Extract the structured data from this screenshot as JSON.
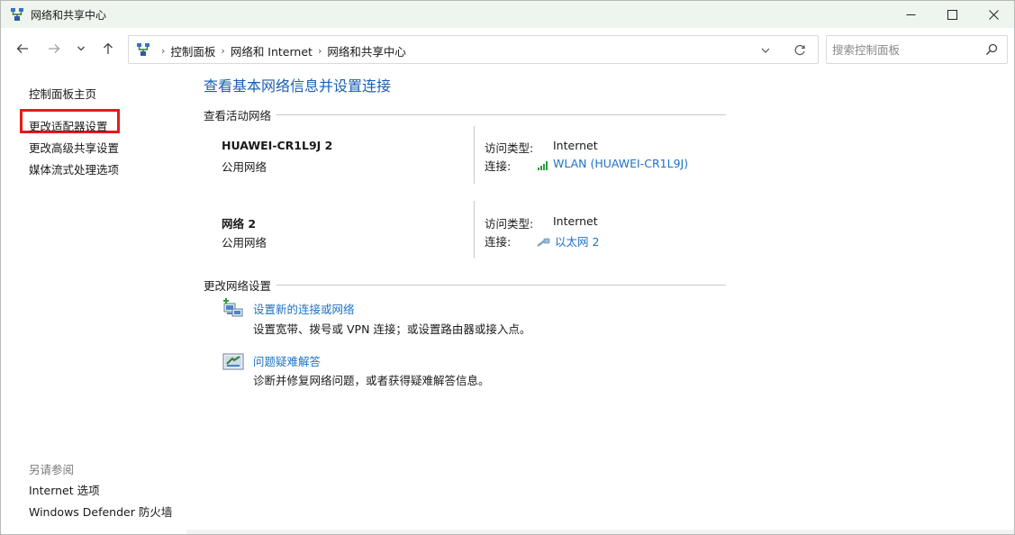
{
  "window": {
    "title": "网络和共享中心"
  },
  "navigation": {
    "breadcrumbs": [
      "控制面板",
      "网络和 Internet",
      "网络和共享中心"
    ],
    "search_placeholder": "搜索控制面板"
  },
  "left_pane": {
    "links": [
      "控制面板主页",
      "更改适配器设置",
      "更改高级共享设置",
      "媒体流式处理选项"
    ],
    "highlighted_index": 1,
    "see_also_title": "另请参阅",
    "see_also_links": [
      "Internet 选项",
      "Windows Defender 防火墙"
    ]
  },
  "main": {
    "title": "查看基本网络信息并设置连接",
    "active_networks_heading": "查看活动网络",
    "networks": [
      {
        "name": "HUAWEI-CR1L9J 2",
        "type": "公用网络",
        "access_label": "访问类型:",
        "access_value": "Internet",
        "connection_label": "连接:",
        "connection_value": "WLAN (HUAWEI-CR1L9J)",
        "connection_icon": "wifi-signal-icon"
      },
      {
        "name": "网络 2",
        "type": "公用网络",
        "access_label": "访问类型:",
        "access_value": "Internet",
        "connection_label": "连接:",
        "connection_value": "以太网 2",
        "connection_icon": "ethernet-cable-icon"
      }
    ],
    "change_settings_heading": "更改网络设置",
    "tasks": [
      {
        "link": "设置新的连接或网络",
        "description": "设置宽带、拨号或 VPN 连接；或设置路由器或接入点。",
        "icon": "new-connection-icon"
      },
      {
        "link": "问题疑难解答",
        "description": "诊断并修复网络问题，或者获得疑难解答信息。",
        "icon": "troubleshoot-icon"
      }
    ]
  },
  "colors": {
    "title_bar": "#eef5ee",
    "link": "#1d72c4",
    "page_title": "#1d5fb4",
    "highlight": "#e8191b"
  }
}
